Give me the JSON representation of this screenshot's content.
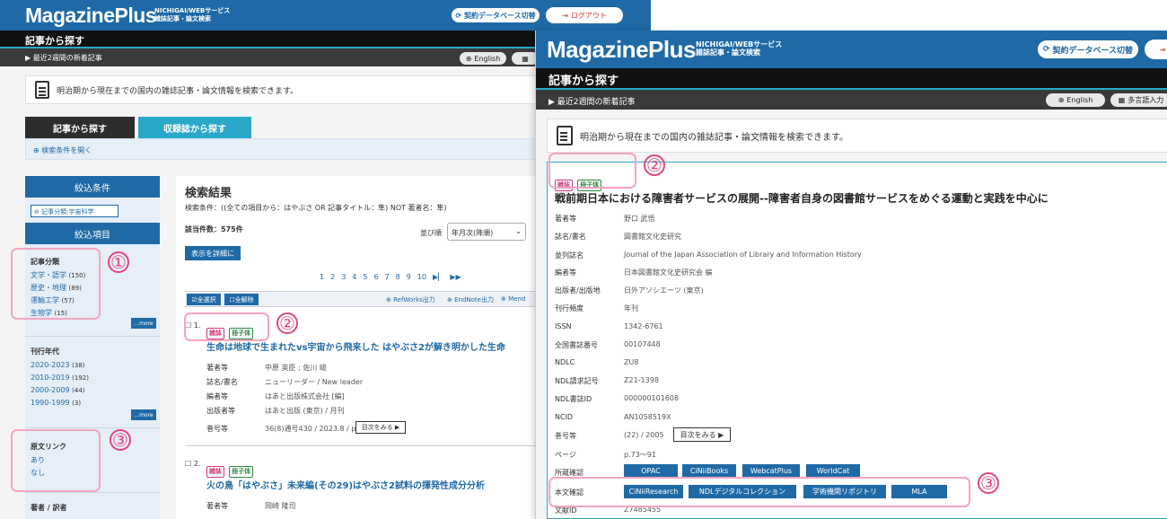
{
  "header": {
    "logo": "MagazinePlus",
    "logo_sub1": "NICHIGAI/WEBサービス",
    "logo_sub2": "雑誌記事・論文検索",
    "db_switch": "契約データベース切替",
    "logout": "ログアウト"
  },
  "titlebar": {
    "title": "記事から探す"
  },
  "subbar": {
    "recent": "▶ 最近2週間の新着記事",
    "english": "English",
    "multilang": "多言語入力"
  },
  "info": {
    "text": "明治期から現在までの国内の雑誌記事・論文情報を検索できます。"
  },
  "tabs": {
    "articles": "記事から探す",
    "magazines": "収録誌から探す",
    "open_conditions": "検索条件を開く"
  },
  "sidebar": {
    "filter_head": "絞込条件",
    "filter_chip": "記事分類:宇宙科学",
    "items_head": "絞込項目",
    "category": {
      "title": "記事分類",
      "items": [
        {
          "label": "文学・語学",
          "count": "(150)"
        },
        {
          "label": "歴史・地理",
          "count": "(89)"
        },
        {
          "label": "運輸工学",
          "count": "(57)"
        },
        {
          "label": "生物学",
          "count": "(15)"
        }
      ],
      "more": "...more"
    },
    "year": {
      "title": "刊行年代",
      "items": [
        {
          "label": "2020-2023",
          "count": "(38)"
        },
        {
          "label": "2010-2019",
          "count": "(192)"
        },
        {
          "label": "2000-2009",
          "count": "(44)"
        },
        {
          "label": "1990-1999",
          "count": "(3)"
        }
      ],
      "more": "...more"
    },
    "fulltext": {
      "title": "原文リンク",
      "items": [
        "あり",
        "なし"
      ]
    },
    "author_title": "著者 / 訳者"
  },
  "results": {
    "title": "検索結果",
    "condition": "検索条件：((全ての項目から：はやぶさ OR 記事タイトル：隼) NOT 著者名：隼)",
    "count": "該当件数：575件",
    "sort_label": "並び順",
    "sort_value": "年月次(降順)",
    "detail_btn": "表示を詳細に",
    "pages": [
      "1",
      "2",
      "3",
      "4",
      "5",
      "6",
      "7",
      "8",
      "9",
      "10"
    ],
    "select_all": "全選択",
    "clear_all": "全解除",
    "refworks": "RefWorks出力",
    "endnote": "EndNote出力",
    "mendeley": "Mend",
    "items": [
      {
        "no": "1.",
        "tag1": "雑誌",
        "tag2": "冊子体",
        "title": "生命は地球で生まれたvs宇宙から飛来した はやぶさ2が解き明かした生命",
        "rows": [
          {
            "k": "著者等",
            "v": "中原 英臣 ; 佐川 峻"
          },
          {
            "k": "誌名/書名",
            "v": "ニューリーダー / New leader"
          },
          {
            "k": "編者等",
            "v": "はあと出版株式会社 [編]"
          },
          {
            "k": "出版者等",
            "v": "はあと出版 (東京) / 月刊"
          },
          {
            "k": "巻号等",
            "v": "36(8)通号430 / 2023.8 / p.44～47"
          }
        ],
        "toc_btn": "目次をみる ▶"
      },
      {
        "no": "2.",
        "tag1": "雑誌",
        "tag2": "冊子体",
        "title": "火の鳥「はやぶさ」未来編(その29)はやぶさ2試料の揮発性成分分析",
        "rows": [
          {
            "k": "著者等",
            "v": "岡崎 隆司"
          }
        ]
      }
    ]
  },
  "detail": {
    "tag1": "雑誌",
    "tag2": "冊子体",
    "title": "戦前期日本における障害者サービスの展開--障害者自身の図書館サービスをめぐる運動と実践を中心に",
    "rows": [
      {
        "k": "著者等",
        "v": "野口 武悟",
        "link": true
      },
      {
        "k": "誌名/書名",
        "v": "図書館文化史研究",
        "link": true
      },
      {
        "k": "並列誌名",
        "v": "Journal of the Japan Association of Library and Information History"
      },
      {
        "k": "編者等",
        "v": "日本図書館文化史研究会 編"
      },
      {
        "k": "出版者/出版地",
        "v": "日外アソシエーツ (東京)"
      },
      {
        "k": "刊行頻度",
        "v": "年刊"
      },
      {
        "k": "ISSN",
        "v": "1342-6761"
      },
      {
        "k": "全国書誌番号",
        "v": "00107448"
      },
      {
        "k": "NDLC",
        "v": "ZU8"
      },
      {
        "k": "NDL請求記号",
        "v": "Z21-1398"
      },
      {
        "k": "NDL書誌ID",
        "v": "000000101608"
      },
      {
        "k": "NCID",
        "v": "AN1058519X"
      },
      {
        "k": "巻号等",
        "v": "(22) / 2005"
      },
      {
        "k": "ページ",
        "v": "p.73～91"
      }
    ],
    "toc_btn": "目次をみる ▶",
    "holdings_label": "所蔵確認",
    "holdings": [
      "OPAC",
      "CiNiiBooks",
      "WebcatPlus",
      "WorldCat"
    ],
    "fulltext_label": "本文確認",
    "fulltext": [
      "CiNiiResearch",
      "NDLデジタルコレクション",
      "学術機関リポジトリ",
      "MLA"
    ],
    "docid_label": "文献ID",
    "docid": "Z7485455"
  },
  "annotations": [
    "①",
    "②",
    "③"
  ]
}
